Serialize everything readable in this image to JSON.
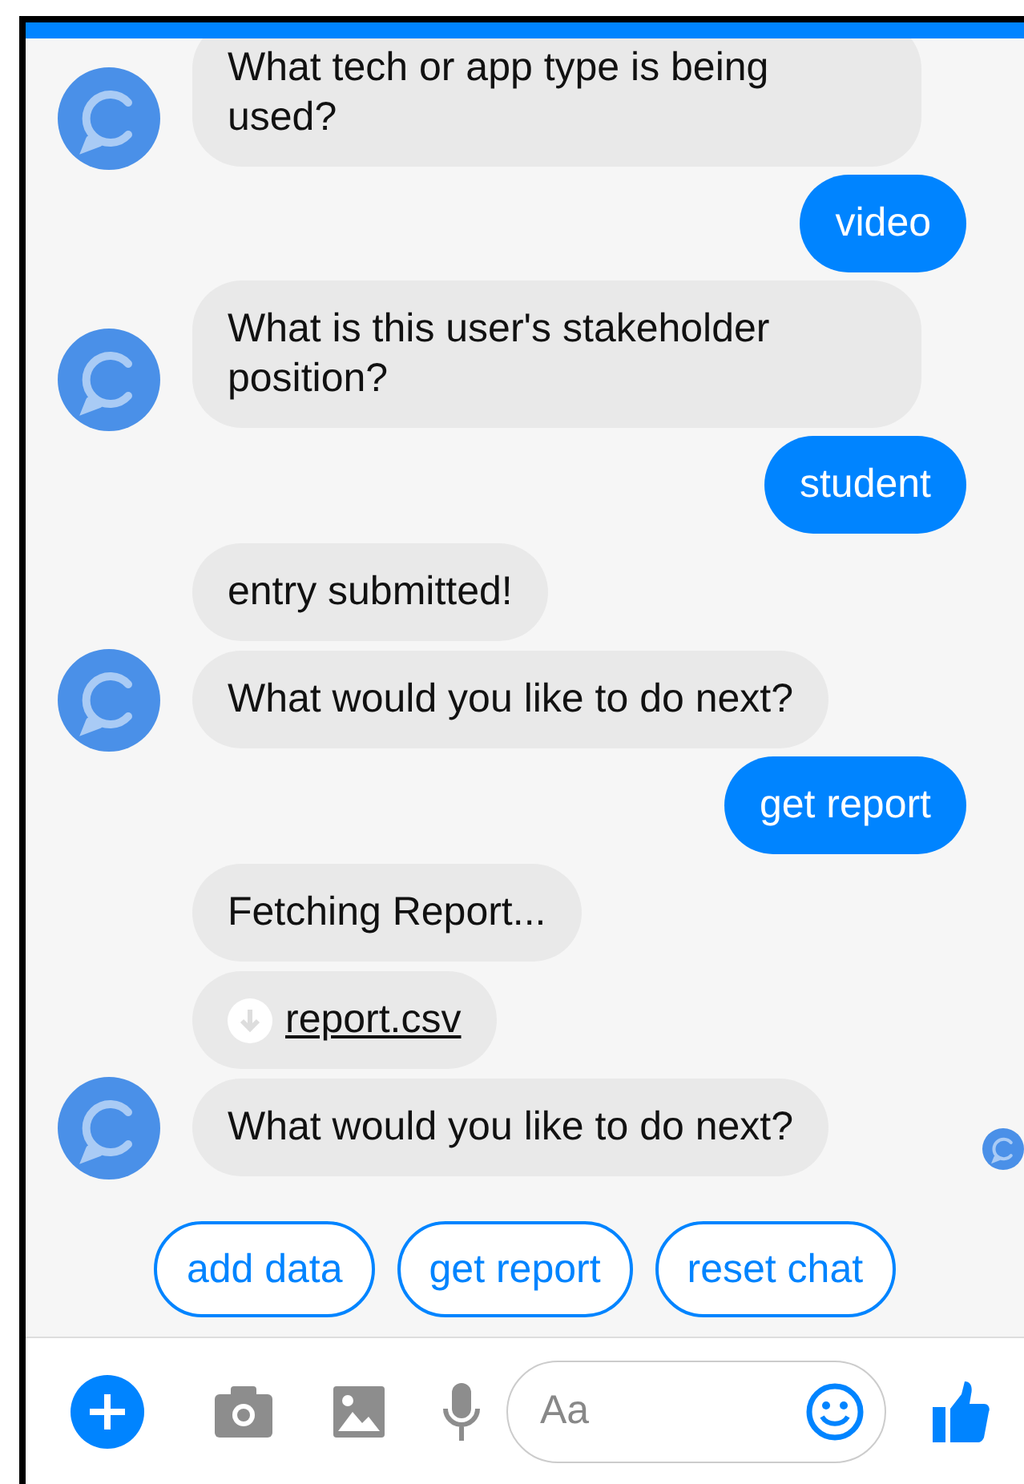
{
  "messages": [
    {
      "kind": "received",
      "text": "What tech or app type is being used?"
    },
    {
      "kind": "sent",
      "text": "video"
    },
    {
      "kind": "received",
      "text": "What is this user's stakeholder position?"
    },
    {
      "kind": "sent",
      "text": "student"
    },
    {
      "kind": "received",
      "text": "entry submitted!"
    },
    {
      "kind": "received",
      "text": "What would you like to do next?"
    },
    {
      "kind": "sent",
      "text": "get report"
    },
    {
      "kind": "received",
      "text": "Fetching Report..."
    },
    {
      "kind": "file",
      "text": "report.csv"
    },
    {
      "kind": "received",
      "text": "What would you like to do next?"
    }
  ],
  "seen": true,
  "quick_replies": [
    "add data",
    "get report",
    "reset chat"
  ],
  "composer": {
    "placeholder": "Aa"
  }
}
